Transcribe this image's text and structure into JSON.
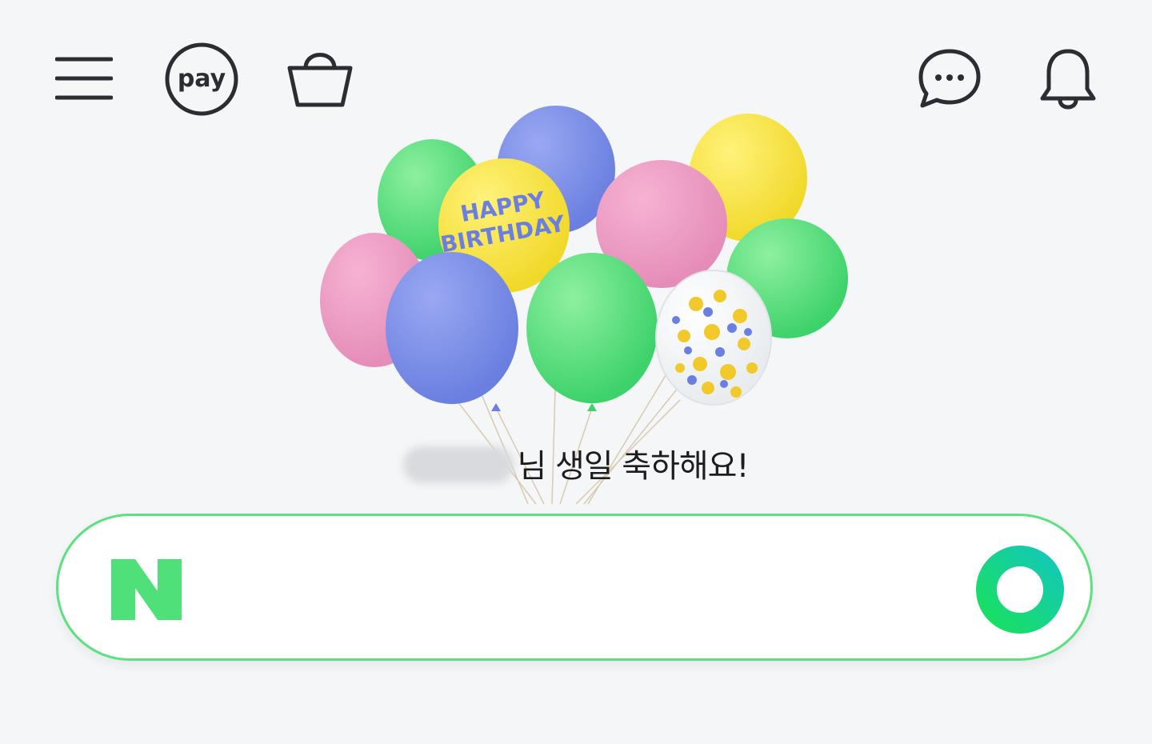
{
  "header": {
    "menu_icon": "hamburger-menu-icon",
    "pay_label": "pay",
    "cart_icon": "shopping-bag-icon",
    "talk_icon": "chat-bubble-icon",
    "bell_icon": "bell-icon"
  },
  "banner": {
    "balloon_text_line1": "HAPPY",
    "balloon_text_line2": "BIRTHDAY",
    "greeting": "님 생일 축하해요!"
  },
  "search": {
    "logo_letter": "N",
    "placeholder": "",
    "value": ""
  },
  "colors": {
    "background": "#f4f6f8",
    "brand_green": "#03c75a",
    "search_border": "#5de07f",
    "icon_dark": "#2b2d33"
  }
}
